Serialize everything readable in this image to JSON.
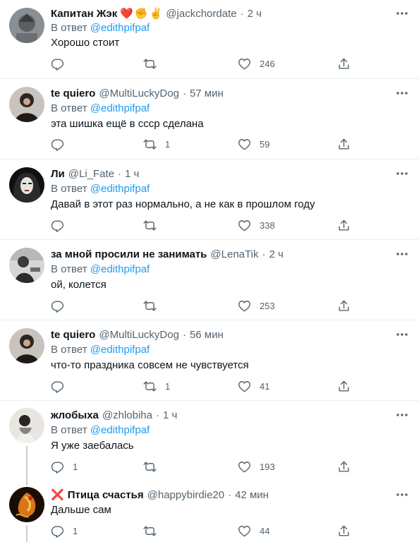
{
  "tweets": [
    {
      "name": "Капитан Жэк",
      "emoji": [
        "❤️",
        "✊",
        "✌️"
      ],
      "handle": "@jackchordate",
      "time": "2 ч",
      "reply_prefix": "В ответ",
      "reply_to": "@edithpifpaf",
      "text": "Хорошо стоит",
      "replies": "",
      "retweets": "",
      "likes": "246"
    },
    {
      "name": "te quiero",
      "handle": "@MultiLuckyDog",
      "time": "57 мин",
      "reply_prefix": "В ответ",
      "reply_to": "@edithpifpaf",
      "text": "эта шишка ещё в ссср сделана",
      "replies": "",
      "retweets": "1",
      "likes": "59"
    },
    {
      "name": "Ли",
      "handle": "@Li_Fate",
      "time": "1 ч",
      "reply_prefix": "В ответ",
      "reply_to": "@edithpifpaf",
      "text": "Давай в этот раз нормально, а не как в прошлом году",
      "replies": "",
      "retweets": "",
      "likes": "338"
    },
    {
      "name": "за мной просили не занимать",
      "handle": "@LenaTik",
      "time": "2 ч",
      "reply_prefix": "В ответ",
      "reply_to": "@edithpifpaf",
      "text": "ой, колется",
      "replies": "",
      "retweets": "",
      "likes": "253"
    },
    {
      "name": "te quiero",
      "handle": "@MultiLuckyDog",
      "time": "56 мин",
      "reply_prefix": "В ответ",
      "reply_to": "@edithpifpaf",
      "text": "что-то праздника совсем не чувствуется",
      "replies": "",
      "retweets": "1",
      "likes": "41"
    },
    {
      "name": "жлобыха",
      "handle": "@zhlobiha",
      "time": "1 ч",
      "reply_prefix": "В ответ",
      "reply_to": "@edithpifpaf",
      "text": "Я уже заебалась",
      "replies": "1",
      "retweets": "",
      "likes": "193"
    },
    {
      "name": "Птица счастья",
      "name_prefix_emoji": "❌",
      "handle": "@happybirdie20",
      "time": "42 мин",
      "text": "Дальше сам",
      "replies": "1",
      "retweets": "",
      "likes": "44"
    }
  ],
  "colors": {
    "text": "#0f1419",
    "secondary": "#536471",
    "link": "#1d9bf0",
    "divider": "#ebeef0",
    "heart": "#e0245e"
  },
  "icons": [
    "more-icon",
    "reply-icon",
    "retweet-icon",
    "like-icon",
    "share-icon"
  ]
}
